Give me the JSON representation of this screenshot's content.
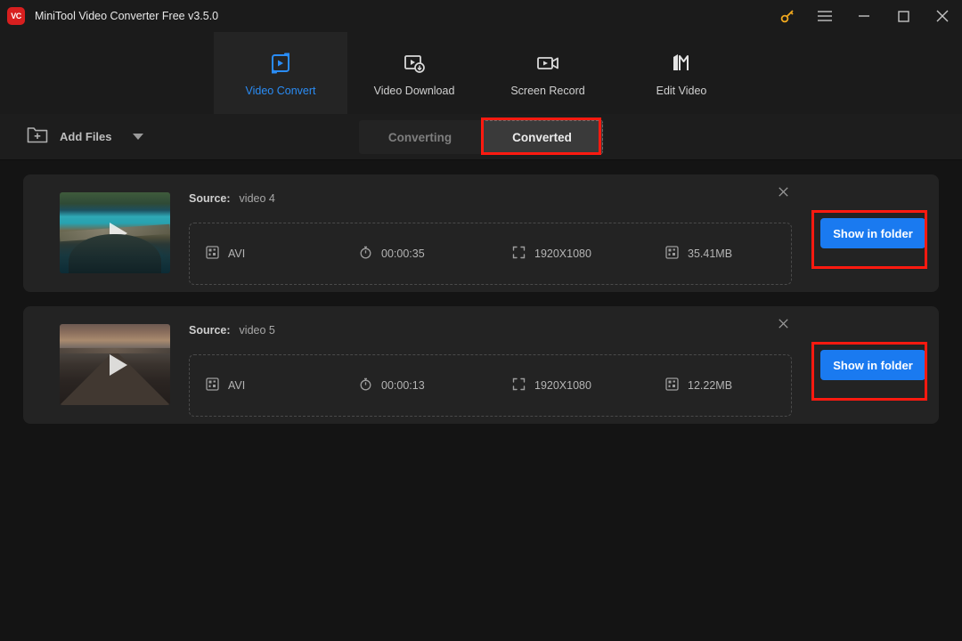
{
  "window": {
    "logo_text": "VC",
    "title": "MiniTool Video Converter Free v3.5.0",
    "controls": {
      "key_icon": "key-icon",
      "menu_icon": "hamburger-menu-icon",
      "minimize_icon": "minimize-icon",
      "maximize_icon": "maximize-icon",
      "close_icon": "close-icon"
    }
  },
  "nav": {
    "tabs": [
      {
        "label": "Video Convert",
        "icon": "video-convert-icon",
        "active": true
      },
      {
        "label": "Video Download",
        "icon": "video-download-icon",
        "active": false
      },
      {
        "label": "Screen Record",
        "icon": "screen-record-icon",
        "active": false
      },
      {
        "label": "Edit Video",
        "icon": "edit-video-icon",
        "active": false
      }
    ],
    "active_color": "#2a8cf5"
  },
  "toolbar": {
    "add_files_label": "Add Files",
    "add_files_icon": "folder-add-icon",
    "dropdown_icon": "caret-down-icon",
    "segments": [
      {
        "label": "Converting",
        "active": false
      },
      {
        "label": "Converted",
        "active": true
      }
    ]
  },
  "files": [
    {
      "source_label": "Source:",
      "source_name": "video 4",
      "thumbnail": "coastal-lagoon-thumbnail",
      "format": "AVI",
      "duration": "00:00:35",
      "resolution": "1920X1080",
      "size": "35.41MB",
      "action_label": "Show in folder",
      "close_icon": "close-icon"
    },
    {
      "source_label": "Source:",
      "source_name": "video 5",
      "thumbnail": "wooden-pier-thumbnail",
      "format": "AVI",
      "duration": "00:00:13",
      "resolution": "1920X1080",
      "size": "12.22MB",
      "action_label": "Show in folder",
      "close_icon": "close-icon"
    }
  ],
  "annotations": {
    "color": "#ff1a10",
    "targets": [
      "Converted",
      "Show in folder",
      "Show in folder"
    ]
  }
}
